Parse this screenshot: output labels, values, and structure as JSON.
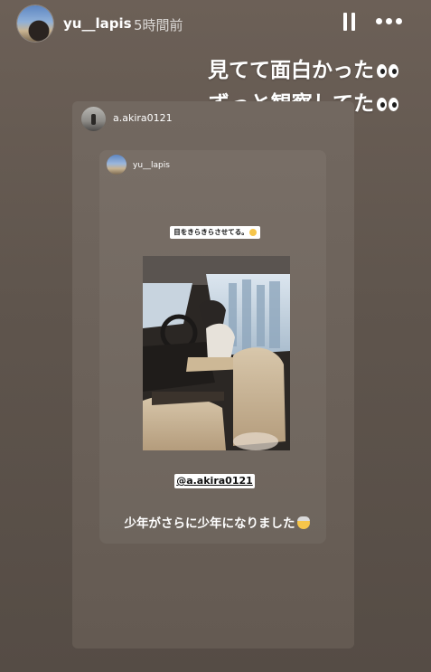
{
  "header": {
    "username": "yu__lapis",
    "time_ago": "5時間前"
  },
  "caption": {
    "line1": "見てて面白かった",
    "line2": "ずっと観察してた"
  },
  "shared_story": {
    "username": "a.akira0121",
    "inner_story": {
      "username": "yu__lapis",
      "sticker_text": "目をきらきらさせてる。",
      "mention": "@a.akira0121",
      "caption": "少年がさらに少年になりました"
    }
  },
  "icons": {
    "pause": "pause-icon",
    "more": "more-options-icon",
    "eyes": "eyes-emoji-icon",
    "face": "old-man-emoji-icon"
  }
}
